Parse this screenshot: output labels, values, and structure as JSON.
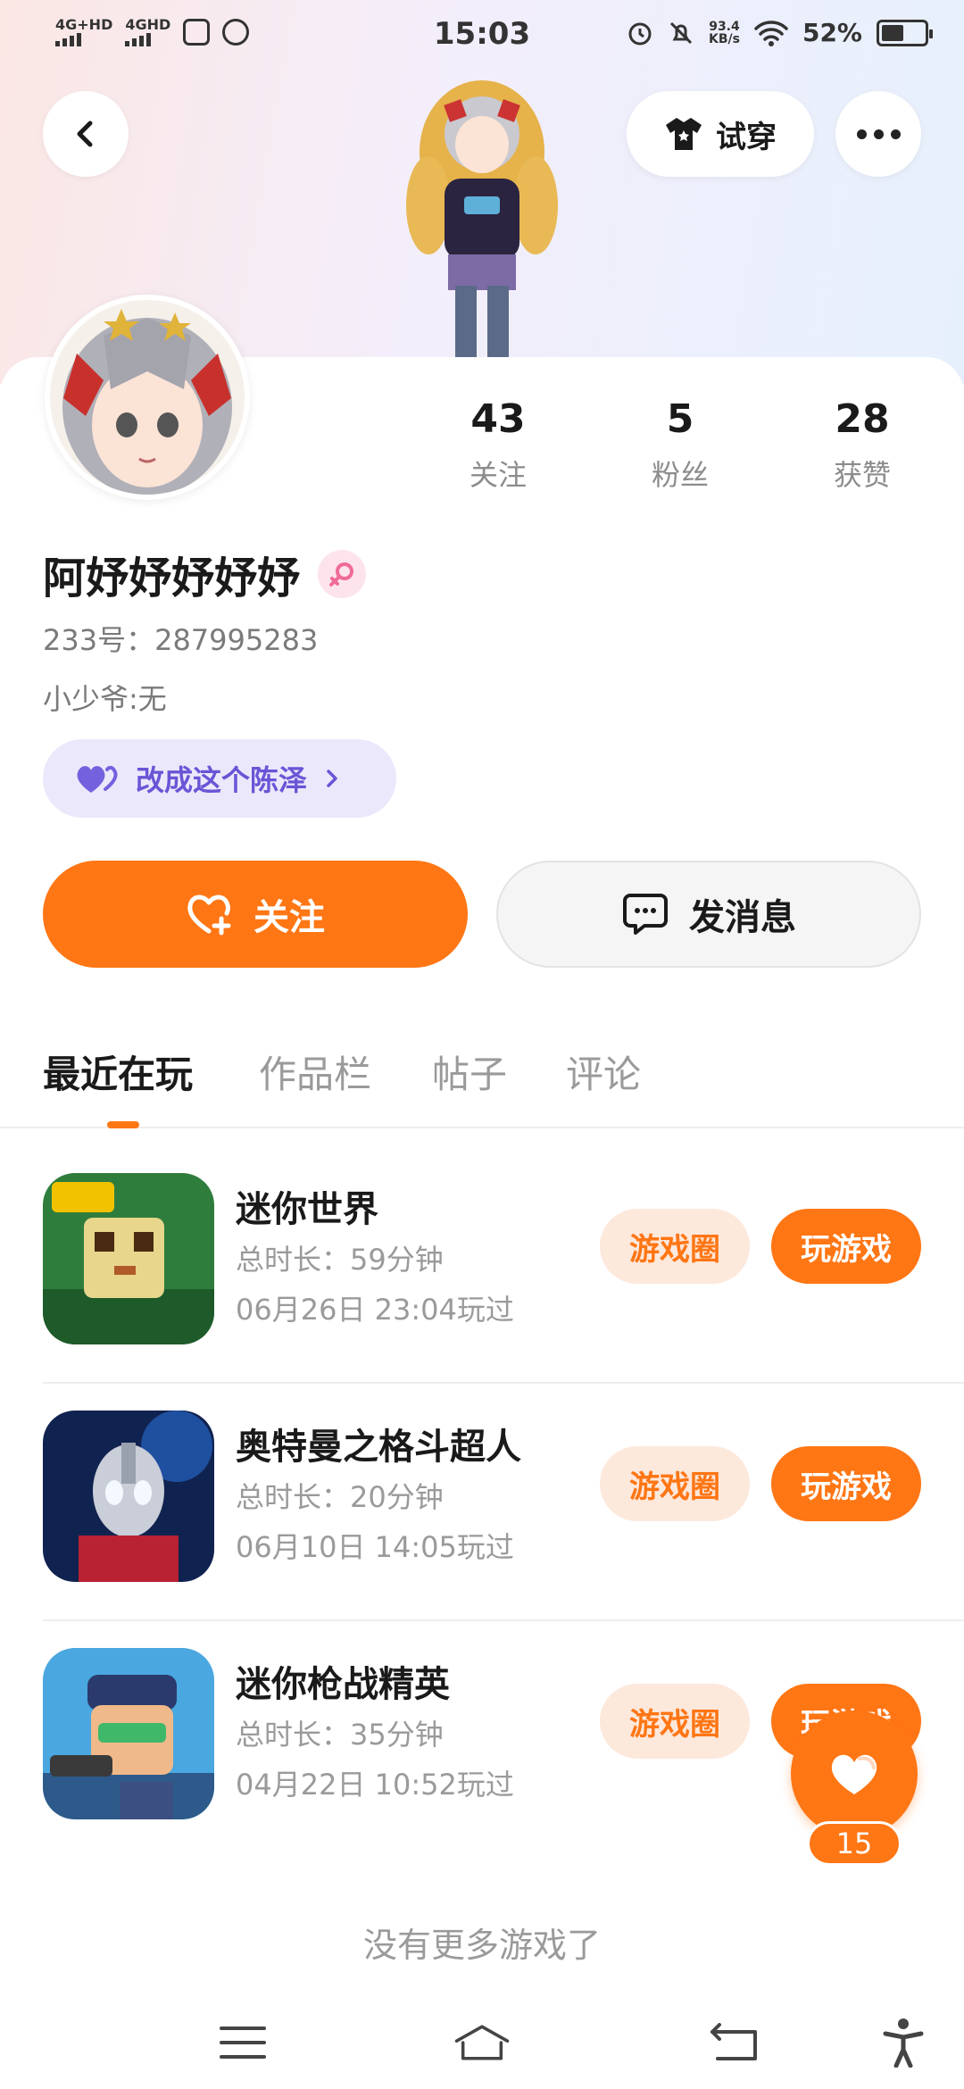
{
  "status_bar": {
    "network1": "4G+HD",
    "network2": "4GHD",
    "time": "15:03",
    "speed_value": "93.4",
    "speed_unit": "KB/s",
    "battery": "52%"
  },
  "header": {
    "try_on_label": "试穿"
  },
  "profile": {
    "nickname": "阿妤妤妤妤妤",
    "uid": "233号：287995283",
    "bio": "小少爷:无",
    "promo_label": "改成这个陈泽",
    "stats": [
      {
        "value": "43",
        "label": "关注"
      },
      {
        "value": "5",
        "label": "粉丝"
      },
      {
        "value": "28",
        "label": "获赞"
      }
    ]
  },
  "actions": {
    "follow_label": "关注",
    "message_label": "发消息"
  },
  "tabs": [
    "最近在玩",
    "作品栏",
    "帖子",
    "评论"
  ],
  "games": [
    {
      "name": "迷你世界",
      "duration": "总时长：59分钟",
      "last_played": "06月26日 23:04玩过",
      "circle_label": "游戏圈",
      "play_label": "玩游戏"
    },
    {
      "name": "奥特曼之格斗超人",
      "duration": "总时长：20分钟",
      "last_played": "06月10日 14:05玩过",
      "circle_label": "游戏圈",
      "play_label": "玩游戏"
    },
    {
      "name": "迷你枪战精英",
      "duration": "总时长：35分钟",
      "last_played": "04月22日 10:52玩过",
      "circle_label": "游戏圈",
      "play_label": "玩游戏"
    }
  ],
  "footer_text": "没有更多游戏了",
  "floating_like": {
    "count": "15"
  },
  "colors": {
    "accent": "#ff7614",
    "accent_light": "#fde8dc",
    "promo_bg": "#ece8fb",
    "promo_text": "#6a55d6"
  }
}
